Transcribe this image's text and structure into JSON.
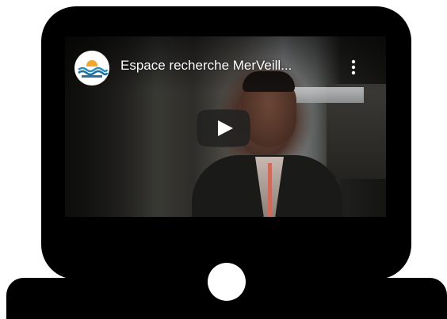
{
  "video": {
    "title": "Espace recherche MerVeill...",
    "channel_avatar_icon": "wave-sun-logo-icon",
    "more_icon": "more-vert-icon",
    "play_icon": "play-icon"
  },
  "colors": {
    "laptop": "#000000",
    "background": "#ffffff",
    "play_button": "#212121",
    "play_triangle": "#ffffff",
    "title_text": "#ffffff"
  }
}
